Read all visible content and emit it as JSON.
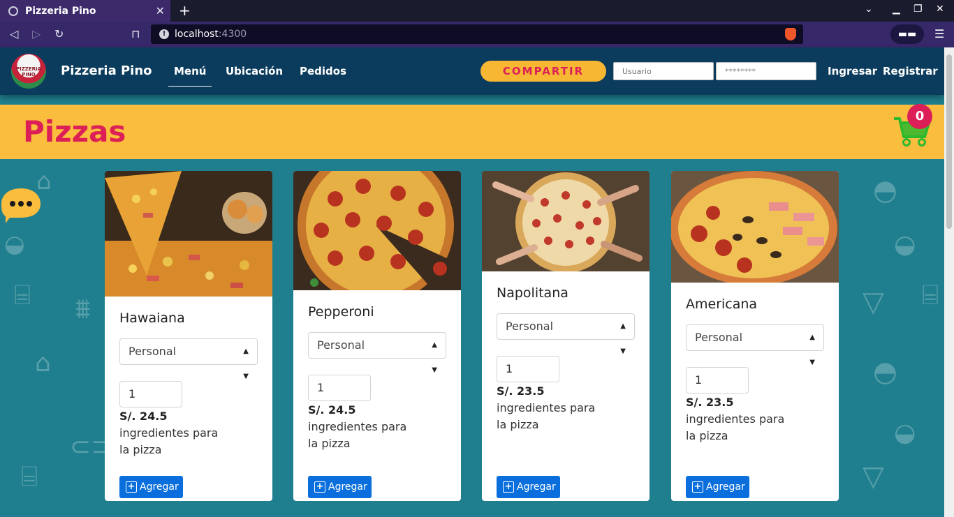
{
  "browser": {
    "tab_title": "Pizzeria Pino",
    "url_host": "localhost",
    "url_port": ":4300"
  },
  "navbar": {
    "logo_text": "PIZZERIA PINO",
    "brand": "Pizzeria Pino",
    "links": [
      "Menú",
      "Ubicación",
      "Pedidos"
    ],
    "share_label": "COMPARTIR",
    "username_placeholder": "Usuario",
    "password_value": "********",
    "login_label": "Ingresar",
    "register_label": "Registrar"
  },
  "banner": {
    "title": "Pizzas",
    "cart_count": "0"
  },
  "pizzas": [
    {
      "name": "Hawaiana",
      "size": "Personal",
      "qty": "1",
      "price": "S/. 24.5",
      "ingredients": "ingredientes para la pizza",
      "button": "Agregar"
    },
    {
      "name": "Pepperoni",
      "size": "Personal",
      "qty": "1",
      "price": "S/. 24.5",
      "ingredients": "ingredientes para la pizza",
      "button": "Agregar"
    },
    {
      "name": "Napolitana",
      "size": "Personal",
      "qty": "1",
      "price": "S/. 23.5",
      "ingredients": "ingredientes para la pizza",
      "button": "Agregar"
    },
    {
      "name": "Americana",
      "size": "Personal",
      "qty": "1",
      "price": "S/. 23.5",
      "ingredients": "ingredientes para la pizza",
      "button": "Agregar"
    }
  ],
  "colors": {
    "navbar": "#0b3c5d",
    "banner": "#fbbd3d",
    "accent_pink": "#dc1f56",
    "background": "#1f7f8e",
    "button_blue": "#0a6fdc"
  }
}
